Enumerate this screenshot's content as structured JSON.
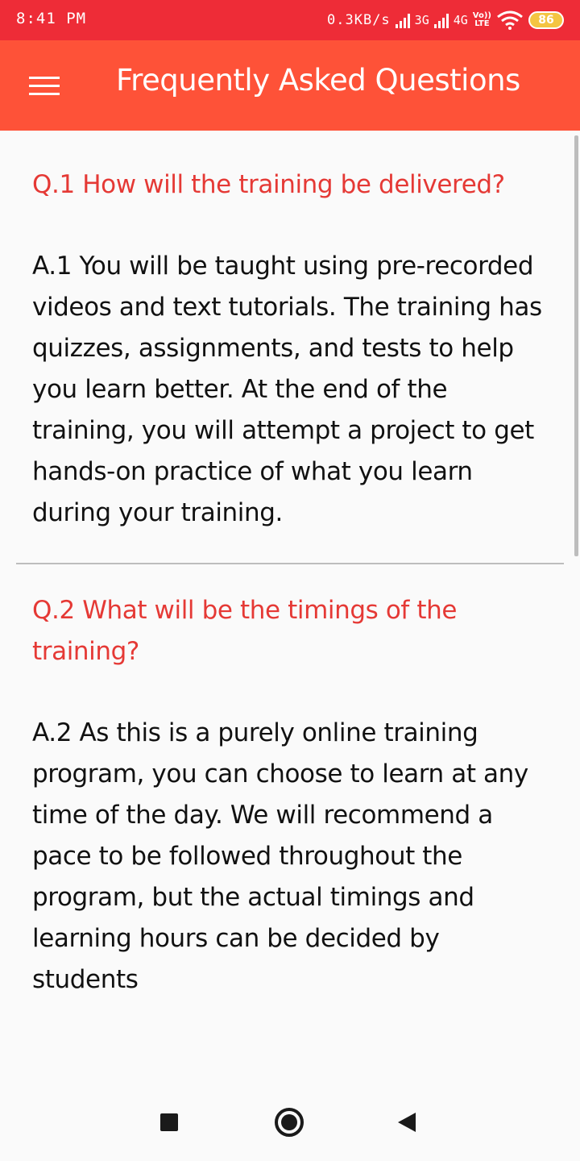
{
  "status_bar": {
    "time": "8:41 PM",
    "net_speed": "0.3KB/s",
    "net_type_1": "3G",
    "net_type_2": "4G",
    "volte_top": "Vo))",
    "volte_bottom": "LTE",
    "battery": "86"
  },
  "app_bar": {
    "title": "Frequently Asked Questions",
    "menu_icon": "hamburger-menu-icon"
  },
  "faqs": [
    {
      "question": "Q.1 How will the training be delivered?",
      "answer": "A.1 You will be taught using pre-recorded videos and text tutorials. The training has quizzes, assignments, and tests to help you learn better. At the end of the training, you will attempt a project to get hands-on practice of what you learn during your training."
    },
    {
      "question": "Q.2 What will be the timings of the training?",
      "answer": "A.2 As this is a purely online training program, you can choose to learn at any time of the day. We will recommend a pace to be followed throughout the program, but the actual timings and learning hours can be decided by students"
    }
  ],
  "colors": {
    "status_bar": "#ee2c37",
    "app_bar": "#fe5238",
    "question_text": "#e53935",
    "answer_text": "#111111",
    "background": "#fafafa"
  },
  "nav_bar": {
    "recent_icon": "recent-apps-icon",
    "home_icon": "home-icon",
    "back_icon": "back-icon"
  }
}
